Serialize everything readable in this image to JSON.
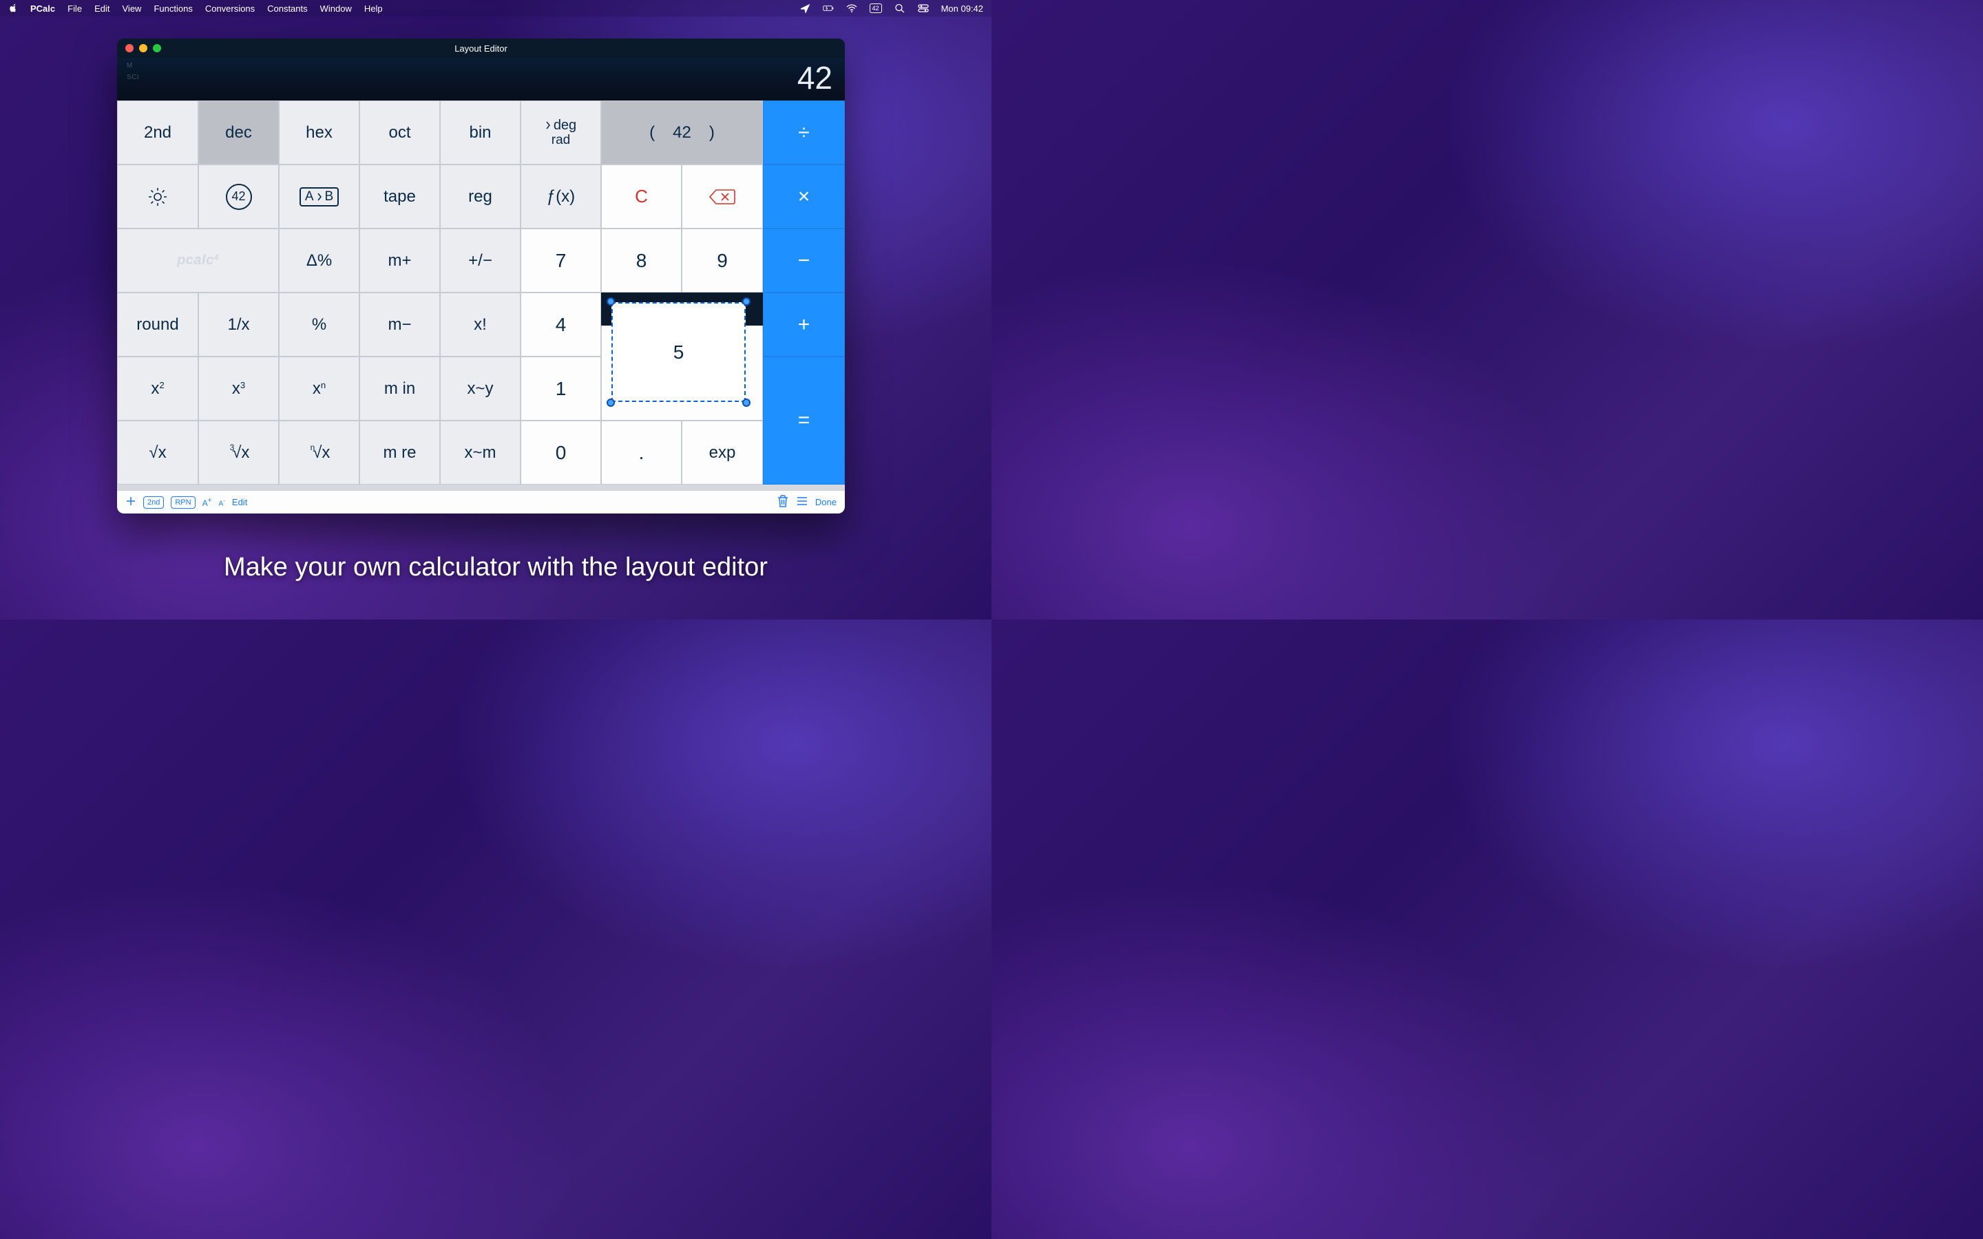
{
  "menubar": {
    "app": "PCalc",
    "items": [
      "File",
      "Edit",
      "View",
      "Functions",
      "Conversions",
      "Constants",
      "Window",
      "Help"
    ],
    "badge42": "42",
    "clock": "Mon 09:42"
  },
  "window": {
    "title": "Layout Editor",
    "flagM": "M",
    "flagSci": "SCI",
    "displayValue": "42"
  },
  "keys": {
    "r0": {
      "second": "2nd",
      "dec": "dec",
      "hex": "hex",
      "oct": "oct",
      "bin": "bin",
      "degTop": "deg",
      "degBot": "rad",
      "paren42": "42",
      "parenL": "(",
      "parenR": ")"
    },
    "r1": {
      "ab_a": "A",
      "ab_b": "B",
      "tape": "tape",
      "reg": "reg",
      "fx": "ƒ(x)",
      "clear": "C",
      "circle42": "42"
    },
    "r2": {
      "pcalc": "pcalc",
      "pcalcPow": "4",
      "deltaPct": "Δ%",
      "mplus": "m+",
      "plusminus": "+/−",
      "d7": "7",
      "d8": "8",
      "d9": "9"
    },
    "r3": {
      "round": "round",
      "inv": "1/x",
      "pct": "%",
      "mminus": "m−",
      "xfact": "x!",
      "d4": "4",
      "d5": "5"
    },
    "r4": {
      "x2b": "x",
      "x2p": "2",
      "x3b": "x",
      "x3p": "3",
      "xnb": "x",
      "xnp": "n",
      "min": "m in",
      "xy": "x~y",
      "d1": "1"
    },
    "r5": {
      "sqrt": "x",
      "cbrt": "x",
      "cbrtN": "3",
      "nrt": "x",
      "nrtN": "n",
      "mre": "m re",
      "xm": "x~m",
      "d0": "0",
      "dot": ".",
      "exp": "exp"
    },
    "ops": {
      "div": "÷",
      "mul": "×",
      "sub": "−",
      "add": "+",
      "eq": "="
    }
  },
  "toolbar": {
    "second": "2nd",
    "rpn": "RPN",
    "aplus": "A",
    "aplusSup": "+",
    "aminus": "A",
    "aminusSup": "-",
    "edit": "Edit",
    "done": "Done"
  },
  "caption": "Make your own calculator with the layout editor"
}
